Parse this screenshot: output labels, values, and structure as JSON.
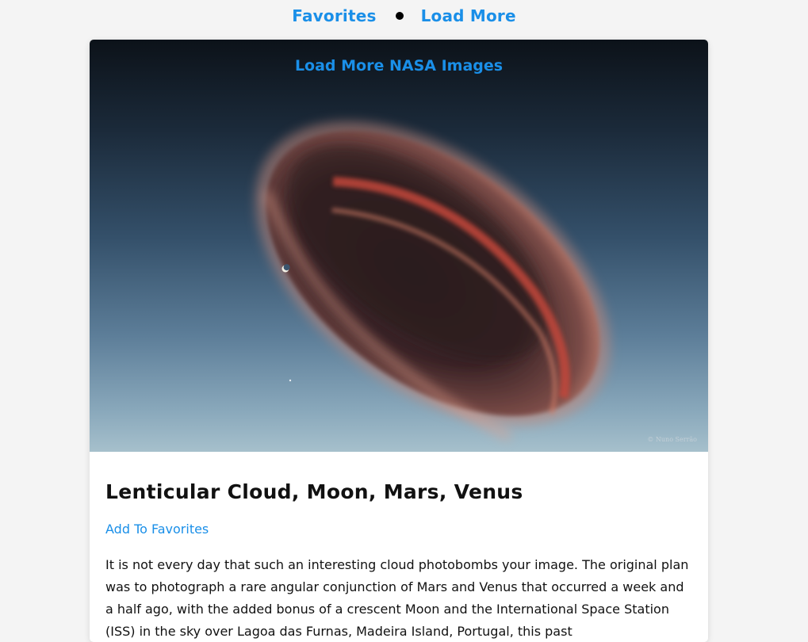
{
  "nav": {
    "favorites_label": "Favorites",
    "load_more_label": "Load More"
  },
  "card": {
    "image": {
      "overlay_link": "Load More NASA Images",
      "credit": "© Nuno Serrão",
      "alt": "Lenticular Cloud, Moon, Mars, Venus"
    },
    "title": "Lenticular Cloud, Moon, Mars, Venus",
    "add_favorites_label": "Add To Favorites",
    "description": "It is not every day that such an interesting cloud photobombs your image. The original plan was to photograph a rare angular conjunction of Mars and Venus that occurred a week and a half ago, with the added bonus of a crescent Moon and the International Space Station (ISS) in the sky over Lagoa das Furnas, Madeira Island, Portugal, this past"
  },
  "colors": {
    "link": "#1a8fe8",
    "background": "#f4f4f4",
    "card": "#ffffff"
  }
}
